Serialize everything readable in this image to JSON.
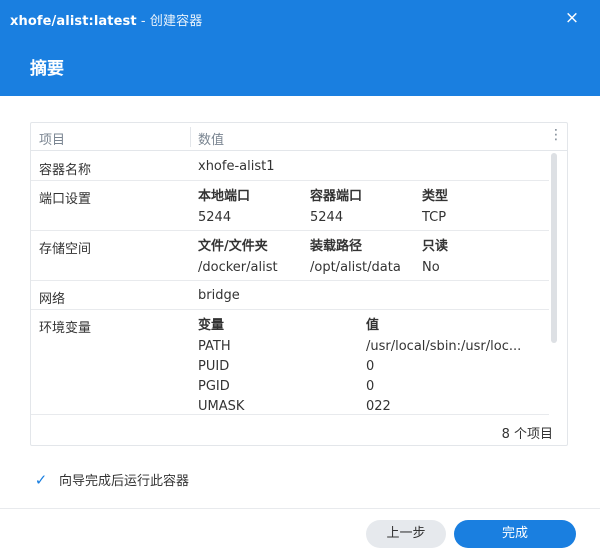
{
  "window": {
    "title": "xhofe/alist:latest",
    "subtitle": " - 创建容器",
    "close_icon": "×"
  },
  "section_title": "摘要",
  "table": {
    "header": {
      "key": "项目",
      "value": "数值",
      "menu_icon": "⋮"
    },
    "rows": {
      "name": {
        "key": "容器名称",
        "value": "xhofe-alist1"
      },
      "ports": {
        "key": "端口设置",
        "headers": [
          "本地端口",
          "容器端口",
          "类型"
        ],
        "values": [
          "5244",
          "5244",
          "TCP"
        ]
      },
      "storage": {
        "key": "存储空间",
        "headers": [
          "文件/文件夹",
          "装载路径",
          "只读"
        ],
        "values": [
          "/docker/alist",
          "/opt/alist/data",
          "No"
        ]
      },
      "network": {
        "key": "网络",
        "value": "bridge"
      },
      "env": {
        "key": "环境变量",
        "headers": [
          "变量",
          "值"
        ],
        "vars": [
          {
            "name": "PATH",
            "value": "/usr/local/sbin:/usr/loc..."
          },
          {
            "name": "PUID",
            "value": "0"
          },
          {
            "name": "PGID",
            "value": "0"
          },
          {
            "name": "UMASK",
            "value": "022"
          }
        ]
      }
    },
    "item_count": "8 个项目"
  },
  "run_after_wizard": {
    "label": "向导完成后运行此容器",
    "checked": true
  },
  "buttons": {
    "prev": "上一步",
    "done": "完成"
  },
  "colors": {
    "accent": "#1a7fe0"
  }
}
